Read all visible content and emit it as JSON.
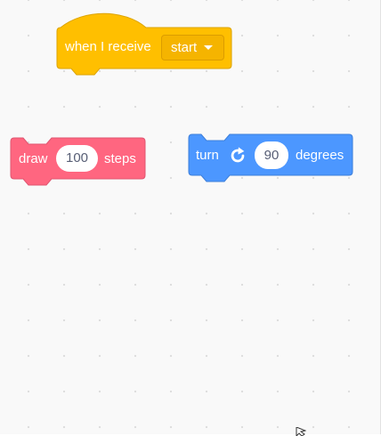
{
  "colors": {
    "events": "#ffbf00",
    "events_dark": "#dca300",
    "pen": "#ff6680",
    "pen_dark": "#e05570",
    "motion": "#4c97ff",
    "motion_dark": "#3d7fd9",
    "input_text": "#575e75",
    "workspace": "#f9f9f9"
  },
  "blocks": {
    "when_receive": {
      "label": "when I receive",
      "selected": "start"
    },
    "draw": {
      "label": "draw",
      "value": "100",
      "suffix": "steps"
    },
    "turn": {
      "label": "turn",
      "icon": "rotate-clockwise-icon",
      "value": "90",
      "suffix": "degrees"
    }
  }
}
